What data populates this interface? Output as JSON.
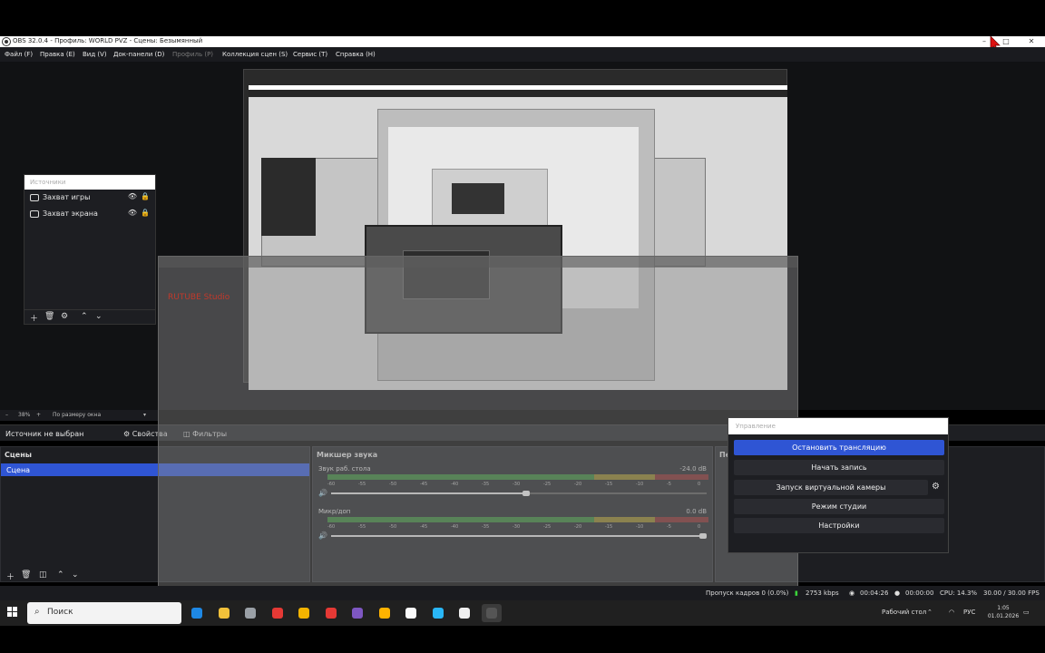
{
  "window": {
    "title": "OBS 32.0.4 - Профиль: WORLD PVZ - Сцены: Безымянный",
    "minimize": "–",
    "maximize": "□",
    "close": "✕"
  },
  "menu": {
    "file": "Файл (F)",
    "edit": "Правка (E)",
    "view": "Вид (V)",
    "docks": "Док-панели (D)",
    "profile": "Профиль (P)",
    "scene_collection": "Коллекция сцен (S)",
    "tools": "Сервис (T)",
    "help": "Справка (H)"
  },
  "sources": {
    "title": "Источники",
    "items": [
      {
        "label": "Захват игры",
        "icon": "gamepad-icon"
      },
      {
        "label": "Захват экрана",
        "icon": "monitor-icon"
      }
    ]
  },
  "overlay": {
    "brand": "RUTUBE Studio"
  },
  "zoom": {
    "level": "38%",
    "fit": "По размеру окна"
  },
  "context": {
    "no_source": "Источник не выбран",
    "properties": "Свойства",
    "filters": "Фильтры"
  },
  "scenes": {
    "title": "Сцены",
    "items": [
      "Сцена"
    ]
  },
  "mixer": {
    "title": "Микшер звука",
    "ticks": [
      "-60",
      "-55",
      "-50",
      "-45",
      "-40",
      "-35",
      "-30",
      "-25",
      "-20",
      "-15",
      "-10",
      "-5",
      "0"
    ],
    "channels": [
      {
        "name": "Звук раб. стола",
        "db": "-24.0 dB",
        "volume": 0.52
      },
      {
        "name": "Микр/доп",
        "db": "0.0 dB",
        "volume": 1.0
      }
    ]
  },
  "controls": {
    "title": "Управление",
    "dock_title": "Пе",
    "stop_stream": "Остановить трансляцию",
    "start_record": "Начать запись",
    "virtual_cam": "Запуск виртуальной камеры",
    "studio_mode": "Режим студии",
    "settings": "Настройки"
  },
  "status": {
    "dropped": "Пропуск кадров 0 (0.0%)",
    "bitrate": "2753 kbps",
    "stream_time": "00:04:26",
    "record_time": "00:00:00",
    "cpu": "CPU: 14.3%",
    "fps": "30.00 / 30.00 FPS"
  },
  "taskbar": {
    "search": "Поиск",
    "desktop": "Рабочий стол",
    "lang": "РУС",
    "time": "1:05",
    "date": "01.01.2026",
    "apps": [
      {
        "name": "edge-icon",
        "color": "#1e88e5"
      },
      {
        "name": "explorer-icon",
        "color": "#f2c13a"
      },
      {
        "name": "app-icon",
        "color": "#9aa0a6"
      },
      {
        "name": "opera-icon",
        "color": "#e53935"
      },
      {
        "name": "chrome-icon",
        "color": "#f4b400"
      },
      {
        "name": "yandex-icon",
        "color": "#e53935"
      },
      {
        "name": "visual-studio-icon",
        "color": "#7e57c2"
      },
      {
        "name": "game-icon",
        "color": "#ffb300"
      },
      {
        "name": "yandex-browser-icon",
        "color": "#fafafa"
      },
      {
        "name": "telegram-icon",
        "color": "#29b6f6"
      },
      {
        "name": "capcut-icon",
        "color": "#eeeeee"
      },
      {
        "name": "obs-icon",
        "color": "#555555"
      }
    ]
  }
}
